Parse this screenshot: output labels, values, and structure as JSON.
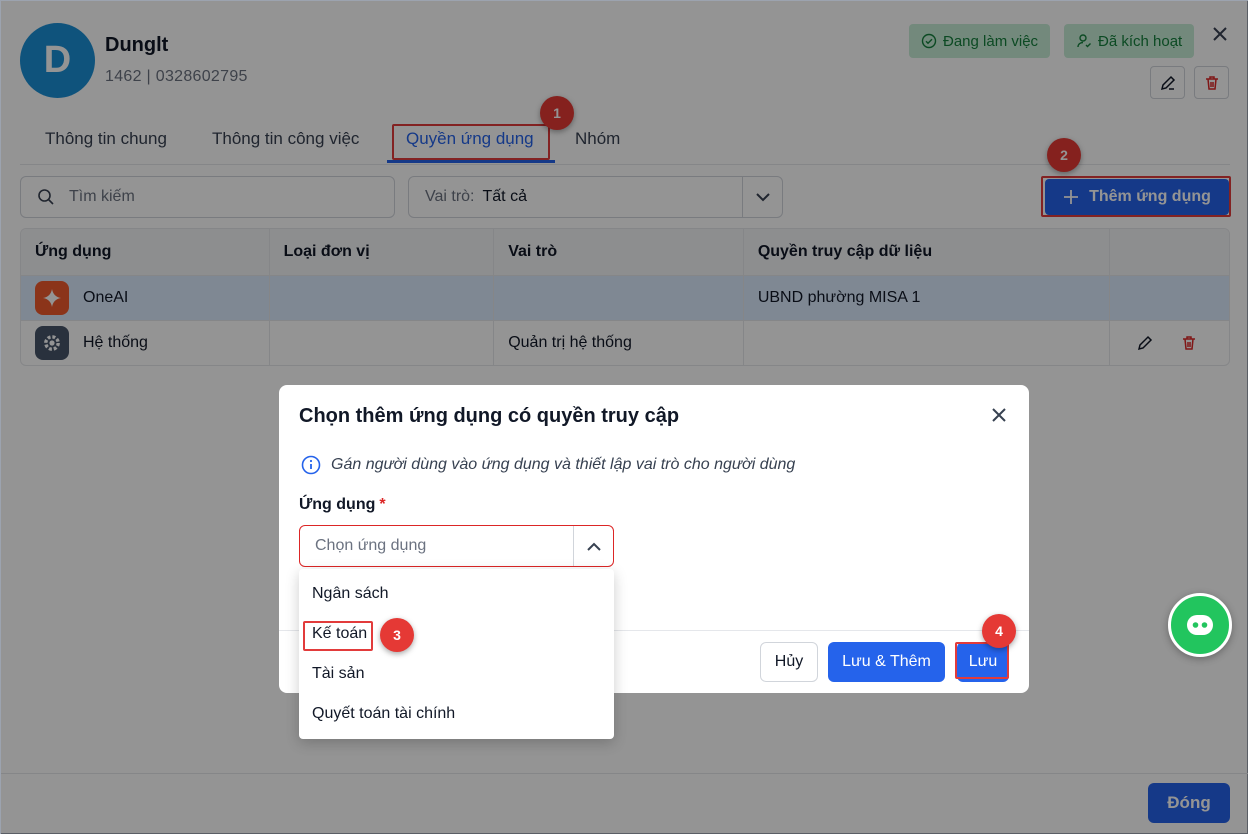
{
  "user": {
    "avatar_letter": "D",
    "name": "Dunglt",
    "meta": "1462 | 0328602795",
    "status_working": "Đang làm việc",
    "status_activated": "Đã kích hoạt"
  },
  "tabs": [
    {
      "label": "Thông tin chung"
    },
    {
      "label": "Thông tin công việc"
    },
    {
      "label": "Quyền ứng dụng"
    },
    {
      "label": "Nhóm"
    }
  ],
  "toolbar": {
    "search_placeholder": "Tìm kiếm",
    "role_label": "Vai trò:",
    "role_value": "Tất cả",
    "add_app_label": "Thêm ứng dụng"
  },
  "table": {
    "headers": [
      "Ứng dụng",
      "Loại đơn vị",
      "Vai trò",
      "Quyền truy cập dữ liệu"
    ],
    "rows": [
      {
        "app": "OneAI",
        "unit_type": "",
        "role": "",
        "data_access": "UBND phường MISA 1"
      },
      {
        "app": "Hệ thống",
        "unit_type": "",
        "role": "Quản trị hệ thống",
        "data_access": ""
      }
    ]
  },
  "dialog": {
    "title": "Chọn thêm ứng dụng có quyền truy cập",
    "info": "Gán người dùng vào ứng dụng và thiết lập vai trò cho người dùng",
    "field_label": "Ứng dụng",
    "required_mark": "*",
    "select_placeholder": "Chọn ứng dụng",
    "options": [
      "Ngân sách",
      "Kế toán",
      "Tài sản",
      "Quyết toán tài chính"
    ],
    "cancel": "Hủy",
    "save_add": "Lưu & Thêm",
    "save": "Lưu"
  },
  "steps": [
    "1",
    "2",
    "3",
    "4"
  ],
  "footer": {
    "close": "Đóng"
  },
  "colors": {
    "primary": "#2563eb",
    "highlight": "#e23b3b",
    "success": "#22c55e"
  }
}
